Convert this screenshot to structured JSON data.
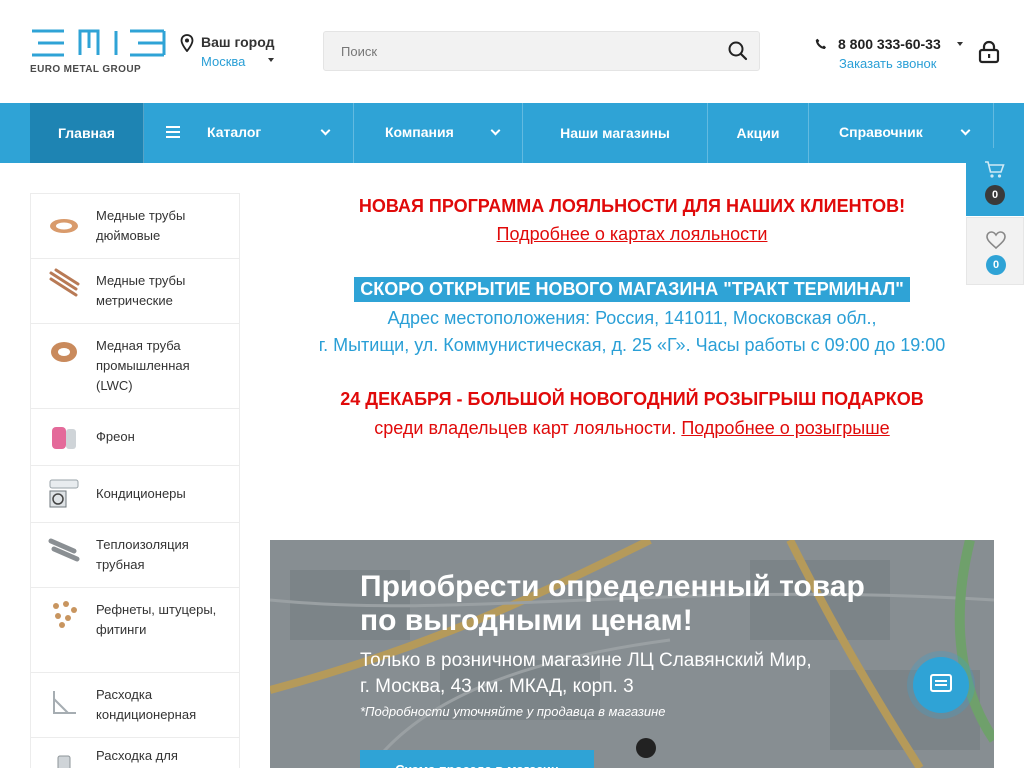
{
  "header": {
    "logo_text": "EURO METAL GROUP",
    "city_label": "Ваш город",
    "city_name": "Москва",
    "search_placeholder": "Поиск",
    "phone": "8 800 333-60-33",
    "callback": "Заказать звонок"
  },
  "nav": {
    "items": [
      {
        "label": "Главная"
      },
      {
        "label": "Каталог"
      },
      {
        "label": "Компания"
      },
      {
        "label": "Наши магазины"
      },
      {
        "label": "Акции"
      },
      {
        "label": "Справочник"
      }
    ]
  },
  "floating": {
    "cart_count": "0",
    "favorites_count": "0"
  },
  "sidebar": {
    "items": [
      {
        "label": "Медные трубы дюймовые"
      },
      {
        "label": "Медные трубы метрические"
      },
      {
        "label": "Медная труба промышленная (LWC)"
      },
      {
        "label": "Фреон"
      },
      {
        "label": "Кондиционеры"
      },
      {
        "label": "Теплоизоляция трубная"
      },
      {
        "label": "Рефнеты, штуцеры, фитинги"
      },
      {
        "label": "Расходка кондиционерная"
      },
      {
        "label": "Расходка для"
      }
    ]
  },
  "promo": {
    "loyalty_title": "НОВАЯ ПРОГРАММА ЛОЯЛЬНОСТИ ДЛЯ НАШИХ КЛИЕНТОВ!",
    "loyalty_link": "Подробнее о картах лояльности",
    "store_title": "СКОРО ОТКРЫТИЕ НОВОГО МАГАЗИНА \"ТРАКТ ТЕРМИНАЛ\"",
    "address_1": "Адрес местоположения: Россия, 141011, Московская обл.,",
    "address_2": "г. Мытищи, ул. Коммунистическая, д. 25 «Г». Часы работы с 09:00 до 19:00",
    "raffle_title": "24 ДЕКАБРЯ - БОЛЬШОЙ НОВОГОДНИЙ РОЗЫГРЫШ ПОДАРКОВ",
    "raffle_text": "среди владельцев карт лояльности.",
    "raffle_link": "Подробнее о розыгрыше"
  },
  "banner": {
    "title_1": "Приобрести определенный товар",
    "title_2": "по выгодными ценам!",
    "sub_1": "Только в розничном магазине ЛЦ Славянский Мир,",
    "sub_2": "г. Москва, 43 км. МКАД, корп. 3",
    "note": "*Подробности уточняйте у продавца в магазине",
    "button": "Схема проезда в магазин"
  },
  "colors": {
    "accent": "#2fa3d6",
    "accent_dark": "#1e84b3",
    "alert_red": "#e00a0a"
  }
}
